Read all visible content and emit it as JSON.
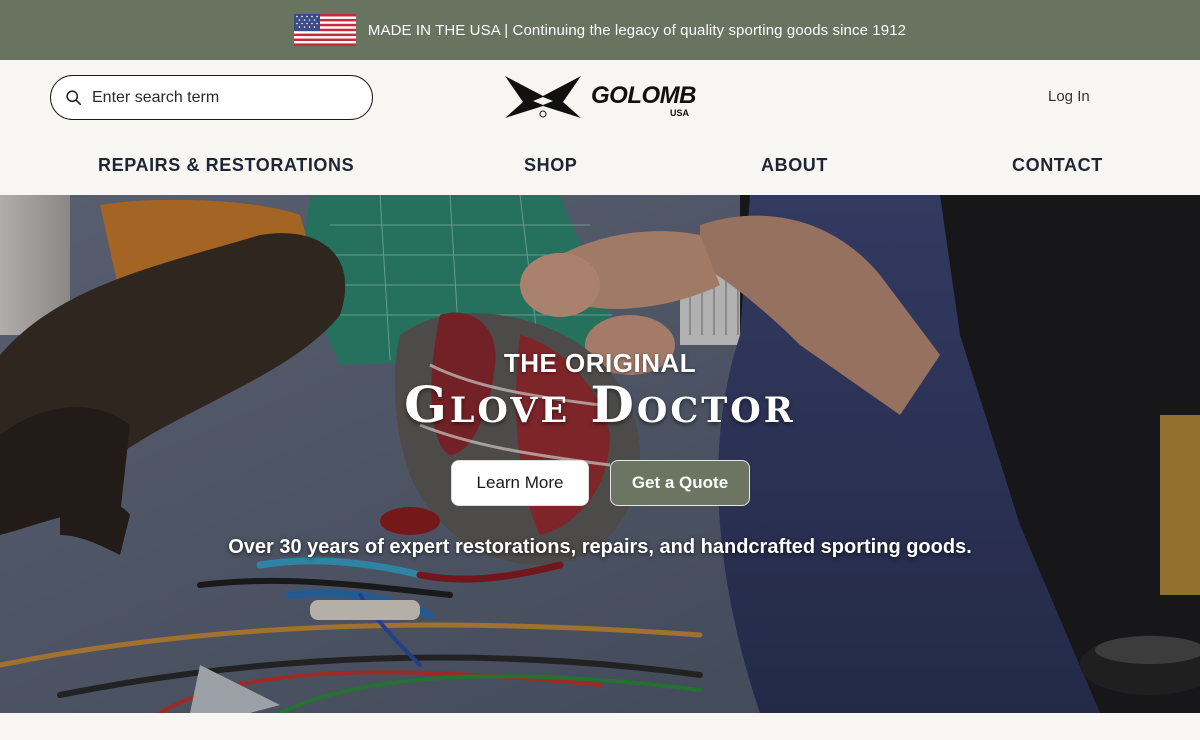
{
  "announcement": {
    "flag_icon": "us-flag-icon",
    "text": "MADE IN THE USA | Continuing the legacy of quality sporting goods since 1912"
  },
  "header": {
    "search": {
      "placeholder": "Enter search term",
      "value": ""
    },
    "logo": {
      "word": "GOLOMB",
      "sub": "USA",
      "mark": "®"
    },
    "login_label": "Log In"
  },
  "nav": {
    "items": [
      {
        "label": "REPAIRS & RESTORATIONS"
      },
      {
        "label": "SHOP"
      },
      {
        "label": "ABOUT"
      },
      {
        "label": "CONTACT"
      }
    ]
  },
  "hero": {
    "eyebrow": "THE ORIGINAL",
    "headline": "Glove Doctor",
    "learn_more": "Learn More",
    "get_quote": "Get a Quote",
    "tagline": "Over 30 years of expert restorations, repairs, and handcrafted sporting goods."
  },
  "colors": {
    "brand_green": "#687360",
    "quote_button": "#6b7562",
    "background": "#f8f6f3",
    "nav_text": "#1e2533"
  }
}
